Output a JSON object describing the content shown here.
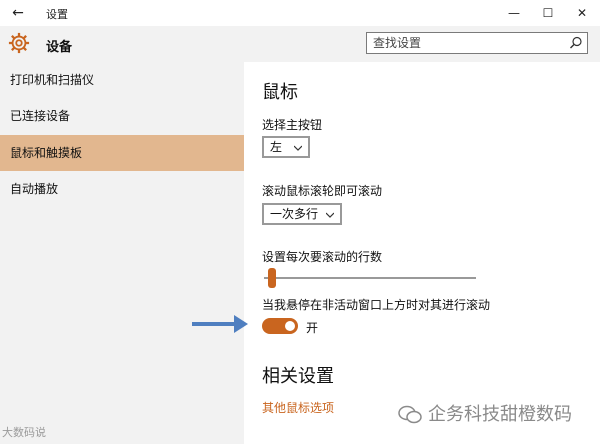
{
  "window": {
    "title": "设置",
    "back_icon": "back-arrow-icon",
    "min_icon": "minimize-icon",
    "max_icon": "maximize-icon",
    "close_icon": "close-icon"
  },
  "header": {
    "title": "设备",
    "icon": "gear-icon",
    "search_placeholder": "查找设置",
    "search_icon": "search-icon"
  },
  "sidebar": {
    "items": [
      {
        "label": "打印机和扫描仪",
        "active": false
      },
      {
        "label": "已连接设备",
        "active": false
      },
      {
        "label": "鼠标和触摸板",
        "active": true
      },
      {
        "label": "自动播放",
        "active": false
      }
    ]
  },
  "main": {
    "section_title": "鼠标",
    "primary_button": {
      "label": "选择主按钮",
      "value": "左"
    },
    "wheel_scroll": {
      "label": "滚动鼠标滚轮即可滚动",
      "value": "一次多行"
    },
    "lines_to_scroll": {
      "label": "设置每次要滚动的行数",
      "slider_fraction": 0.02
    },
    "inactive_scroll": {
      "label": "当我悬停在非活动窗口上方时对其进行滚动",
      "state": "开",
      "on": true
    },
    "related_title": "相关设置",
    "related_link": "其他鼠标选项"
  },
  "annotation": {
    "arrow_color": "#4f7fc0"
  },
  "watermarks": {
    "left": "大数码说",
    "right": "企务科技甜橙数码"
  },
  "colors": {
    "accent": "#c9651f",
    "sidebar_active": "#e2b78f",
    "sidebar_bg": "#f2f2f2"
  }
}
